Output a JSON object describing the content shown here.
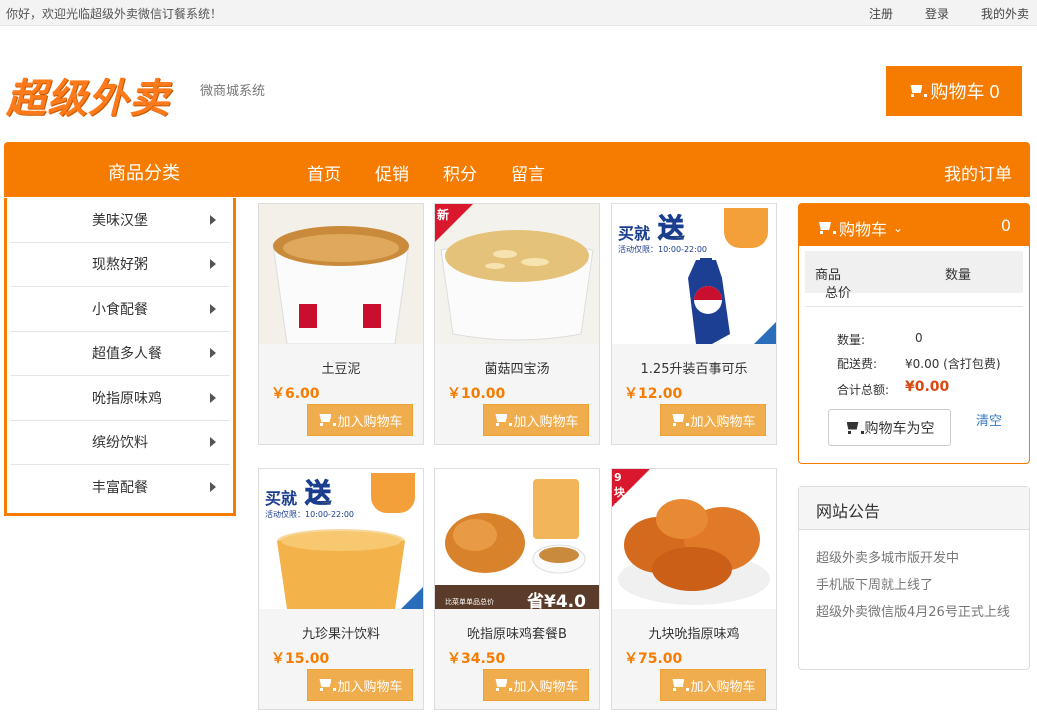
{
  "topbar": {
    "welcome": "你好，欢迎光临超级外卖微信订餐系统！",
    "links": [
      "注册",
      "登录",
      "我的外卖"
    ]
  },
  "header": {
    "logo": "超级外卖",
    "subtitle": "微商城系统",
    "cart_label": "购物车 0"
  },
  "nav": {
    "category_title": "商品分类",
    "menu": [
      "首页",
      "促销",
      "积分",
      "留言"
    ],
    "my_orders": "我的订单"
  },
  "categories": [
    "美味汉堡",
    "现熬好粥",
    "小食配餐",
    "超值多人餐",
    "吮指原味鸡",
    "缤纷饮料",
    "丰富配餐"
  ],
  "add_to_cart_label": "加入购物车",
  "products": [
    {
      "name": "土豆泥",
      "price": "￥6.00"
    },
    {
      "name": "菌菇四宝汤",
      "price": "￥10.00",
      "badge": "新"
    },
    {
      "name": "1.25升装百事可乐",
      "price": "￥12.00",
      "promo": "买就",
      "promo_big": "送",
      "promo_time": "活动仅限：10:00-22:00"
    },
    {
      "name": "九珍果汁饮料",
      "price": "￥15.00",
      "promo": "买就",
      "promo_big": "送",
      "promo_time": "活动仅限：10:00-22:00"
    },
    {
      "name": "吮指原味鸡套餐B",
      "price": "￥34.50",
      "save_text": "省¥4.0",
      "footer_text": "比菜单单品总价"
    },
    {
      "name": "九块吮指原味鸡",
      "price": "￥75.00",
      "badge": "9块装"
    }
  ],
  "cart_panel": {
    "title": "购物车",
    "count": "0",
    "col_product": "商品",
    "col_qty": "数量",
    "col_total": "总价",
    "qty_label": "数量:",
    "qty_value": "0",
    "shipping_label": "配送费:",
    "shipping_value": "¥0.00 (含打包费)",
    "total_label": "合计总额:",
    "total_value": "¥0.00",
    "empty_button": "购物车为空",
    "clear": "清空"
  },
  "notice": {
    "title": "网站公告",
    "lines": [
      "超级外卖多城市版开发中",
      "手机版下周就上线了",
      "超级外卖微信版4月26号正式上线"
    ]
  },
  "colors": {
    "accent": "#f57c00",
    "button": "#f0ad4e"
  }
}
